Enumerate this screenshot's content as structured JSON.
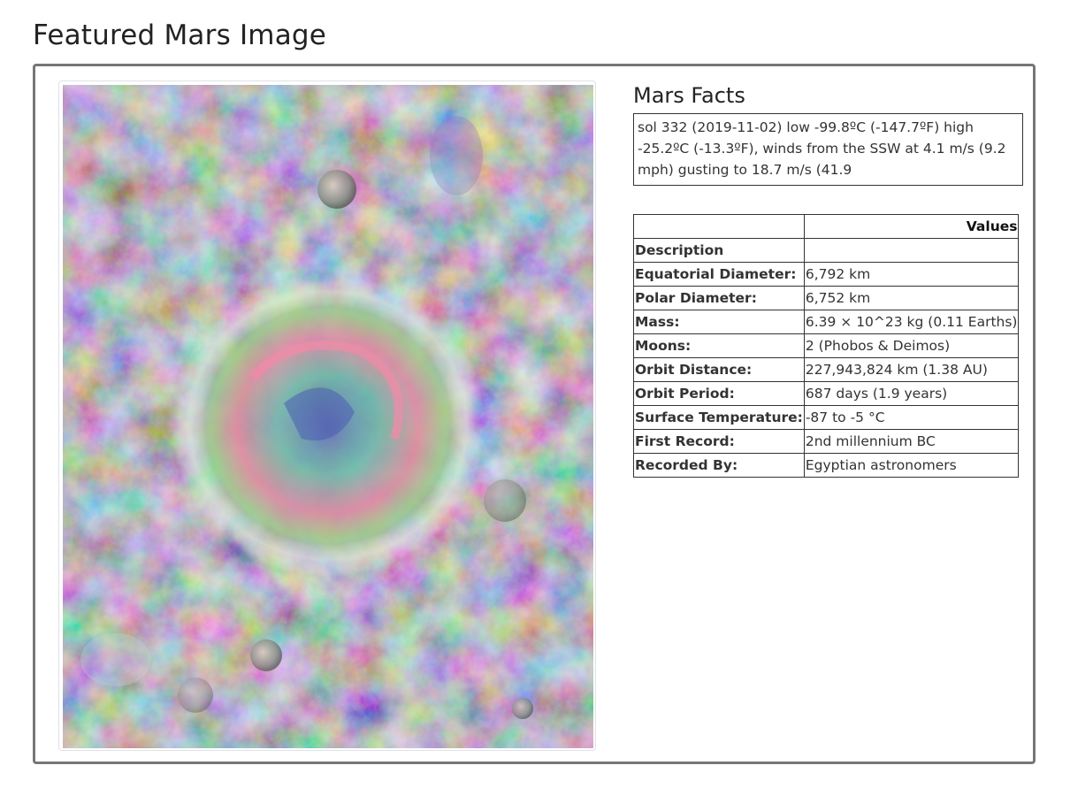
{
  "page": {
    "title": "Featured Mars Image"
  },
  "image": {
    "alt": "Featured Mars image: false-color view of a crater"
  },
  "facts": {
    "title": "Mars Facts",
    "weather": "sol 332 (2019-11-02) low -99.8ºC (-147.7ºF) high -25.2ºC (-13.3ºF), winds from the SSW at 4.1 m/s (9.2 mph) gusting to 18.7 m/s (41.9",
    "table": {
      "header_key": "",
      "header_value": "Values",
      "rows": [
        {
          "key": "Description",
          "value": ""
        },
        {
          "key": "Equatorial Diameter:",
          "value": "6,792 km"
        },
        {
          "key": "Polar Diameter:",
          "value": "6,752 km"
        },
        {
          "key": "Mass:",
          "value": "6.39 × 10^23 kg (0.11 Earths)"
        },
        {
          "key": "Moons:",
          "value": "2 (Phobos & Deimos)"
        },
        {
          "key": "Orbit Distance:",
          "value": "227,943,824 km (1.38 AU)"
        },
        {
          "key": "Orbit Period:",
          "value": "687 days (1.9 years)"
        },
        {
          "key": "Surface Temperature:",
          "value": "-87 to -5 °C"
        },
        {
          "key": "First Record:",
          "value": "2nd millennium BC"
        },
        {
          "key": "Recorded By:",
          "value": "Egyptian astronomers"
        }
      ]
    }
  }
}
